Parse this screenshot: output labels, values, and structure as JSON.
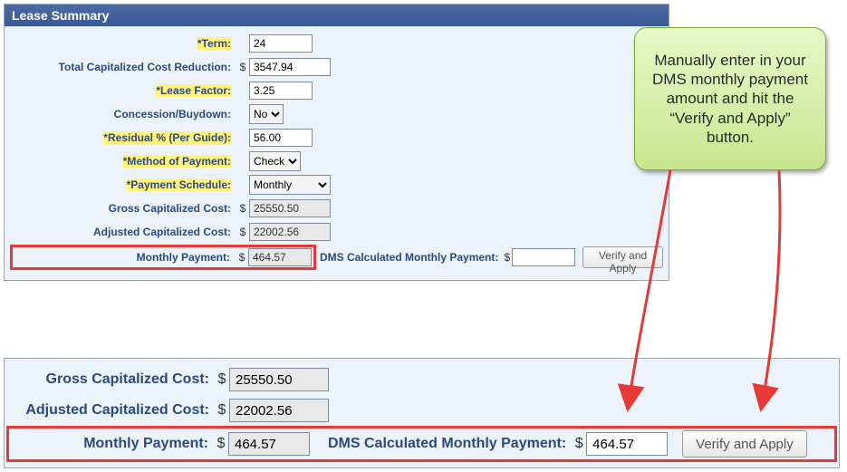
{
  "panel": {
    "title": "Lease Summary",
    "labels": {
      "term": "*Term:",
      "tccr": "Total Capitalized Cost Reduction:",
      "leaseFactor": "*Lease Factor:",
      "concession": "Concession/Buydown:",
      "residual": "*Residual % (Per Guide):",
      "method": "*Method of Payment:",
      "schedule": "*Payment Schedule:",
      "gross": "Gross Capitalized Cost:",
      "adjusted": "Adjusted Capitalized Cost:",
      "monthly": "Monthly Payment:",
      "dmsCalc": "DMS Calculated Monthly Payment:"
    },
    "values": {
      "term": "24",
      "tccr": "3547.94",
      "leaseFactor": "3.25",
      "concession": "No",
      "residual": "56.00",
      "method": "Check",
      "schedule": "Monthly",
      "gross": "25550.50",
      "adjusted": "22002.56",
      "monthly": "464.57",
      "dmsCalc": ""
    },
    "button": "Verify and Apply"
  },
  "zoom": {
    "labels": {
      "gross": "Gross Capitalized Cost:",
      "adjusted": "Adjusted Capitalized Cost:",
      "monthly": "Monthly Payment:",
      "dmsCalc": "DMS Calculated Monthly Payment:"
    },
    "values": {
      "gross": "25550.50",
      "adjusted": "22002.56",
      "monthly": "464.57",
      "dmsCalc": "464.57"
    },
    "button": "Verify and Apply"
  },
  "callout": "Manually enter in your DMS monthly payment amount and hit the “Verify and Apply” button.",
  "dollar": "$"
}
